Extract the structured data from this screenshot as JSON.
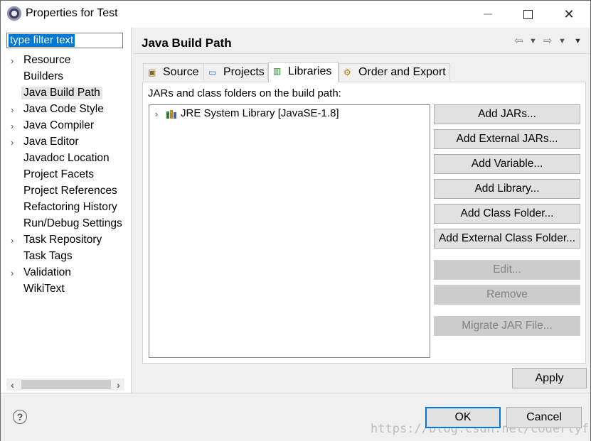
{
  "window": {
    "title": "Properties for Test"
  },
  "filter": {
    "value": "type filter text"
  },
  "tree": {
    "items": [
      {
        "label": "Resource",
        "expandable": true
      },
      {
        "label": "Builders",
        "expandable": false
      },
      {
        "label": "Java Build Path",
        "expandable": false,
        "selected": true
      },
      {
        "label": "Java Code Style",
        "expandable": true
      },
      {
        "label": "Java Compiler",
        "expandable": true
      },
      {
        "label": "Java Editor",
        "expandable": true
      },
      {
        "label": "Javadoc Location",
        "expandable": false
      },
      {
        "label": "Project Facets",
        "expandable": false
      },
      {
        "label": "Project References",
        "expandable": false
      },
      {
        "label": "Refactoring History",
        "expandable": false
      },
      {
        "label": "Run/Debug Settings",
        "expandable": false
      },
      {
        "label": "Task Repository",
        "expandable": true
      },
      {
        "label": "Task Tags",
        "expandable": false
      },
      {
        "label": "Validation",
        "expandable": true
      },
      {
        "label": "WikiText",
        "expandable": false
      }
    ]
  },
  "page": {
    "title": "Java Build Path"
  },
  "tabs": [
    {
      "label": "Source",
      "active": false,
      "icon": "source-folder-icon"
    },
    {
      "label": "Projects",
      "active": false,
      "icon": "projects-folder-icon"
    },
    {
      "label": "Libraries",
      "active": true,
      "icon": "libraries-icon"
    },
    {
      "label": "Order and Export",
      "active": false,
      "icon": "order-export-icon"
    }
  ],
  "libraries": {
    "caption": "JARs and class folders on the build path:",
    "entries": [
      {
        "label": "JRE System Library [JavaSE-1.8]"
      }
    ]
  },
  "buttons": {
    "add_jars": "Add JARs...",
    "add_external_jars": "Add External JARs...",
    "add_variable": "Add Variable...",
    "add_library": "Add Library...",
    "add_class_folder": "Add Class Folder...",
    "add_external_class_folder": "Add External Class Folder...",
    "edit": "Edit...",
    "remove": "Remove",
    "migrate_jar": "Migrate JAR File...",
    "apply": "Apply",
    "ok": "OK",
    "cancel": "Cancel"
  },
  "help": {
    "glyph": "?"
  },
  "watermark": "https://blog.csdn.net/coderlyf",
  "colors": {
    "selection": "#0078d7",
    "default_button_border": "#0078d7"
  }
}
